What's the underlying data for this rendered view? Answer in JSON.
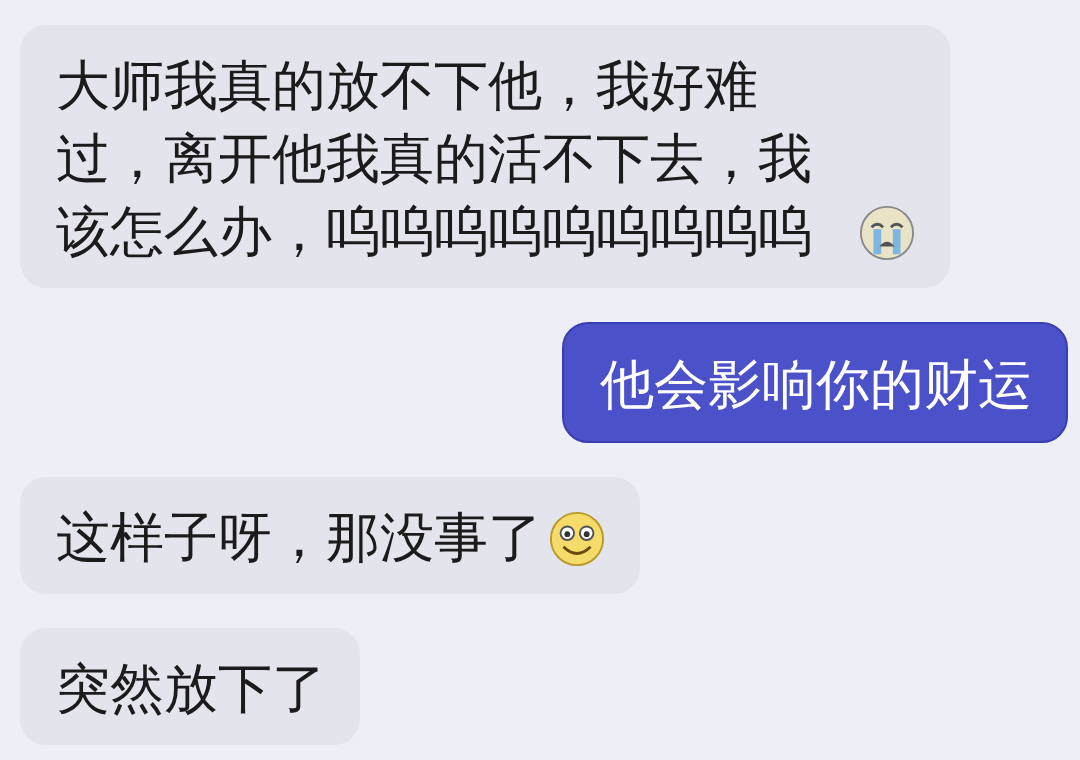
{
  "messages": [
    {
      "kind": "incoming",
      "text": "大师我真的放不下他，我好难过，离开他我真的活不下去，我该怎么办，呜呜呜呜呜呜呜呜呜",
      "emoji": {
        "kind": "crying"
      }
    },
    {
      "kind": "outgoing",
      "text": "他会影响你的财运"
    },
    {
      "kind": "incoming",
      "text": "这样子呀，那没事了",
      "emoji": {
        "kind": "smiling"
      }
    },
    {
      "kind": "incoming",
      "text": "突然放下了"
    }
  ]
}
